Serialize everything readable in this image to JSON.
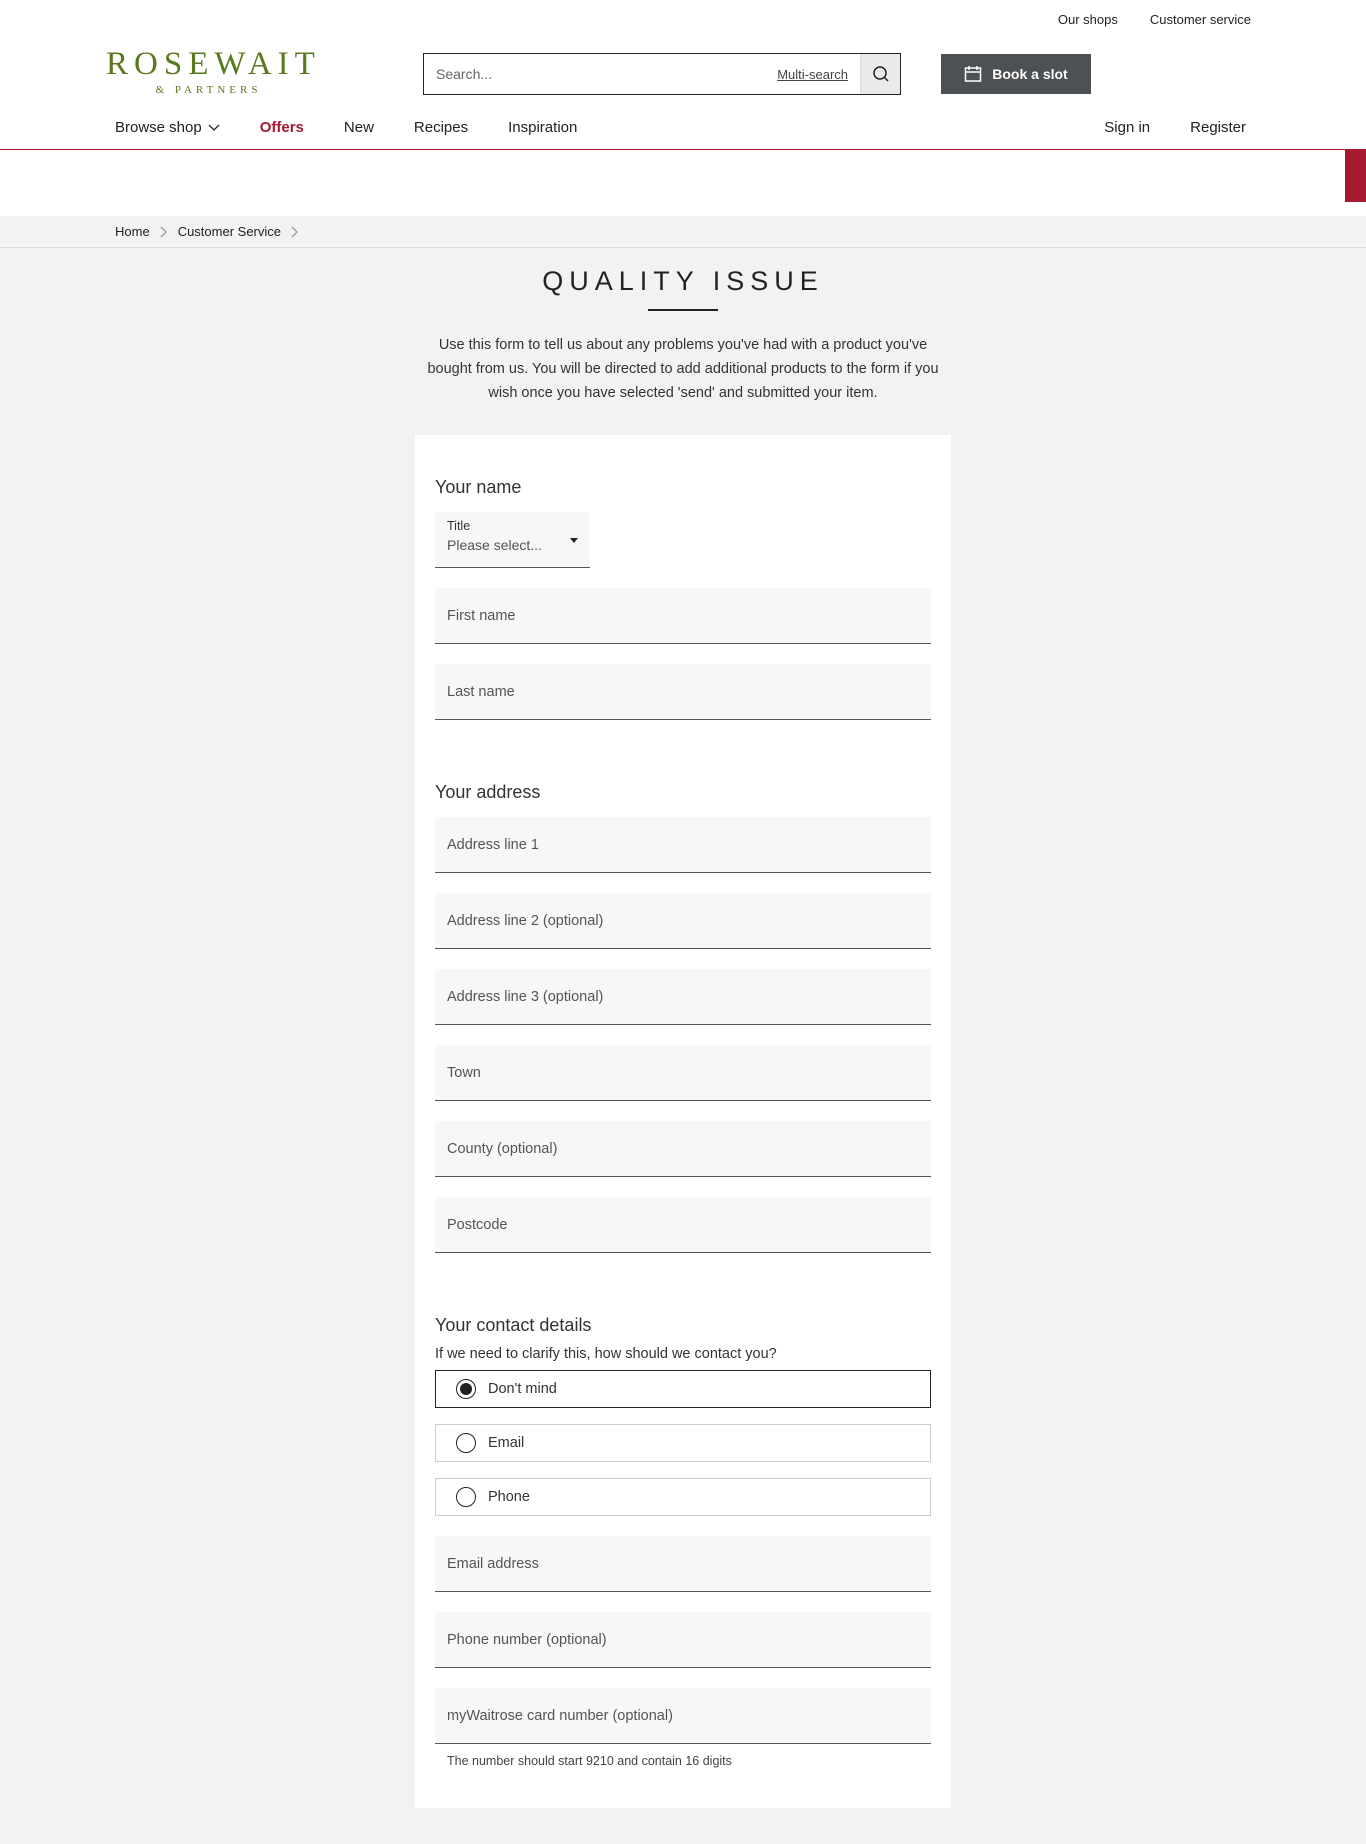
{
  "header": {
    "util_links": [
      "Our shops",
      "Customer service"
    ],
    "logo_main": "ROSEWAIT",
    "logo_sub": "& PARTNERS",
    "search_placeholder": "Search...",
    "multi_search": "Multi-search",
    "book_slot": "Book a slot",
    "nav": [
      "Browse shop",
      "Offers",
      "New",
      "Recipes",
      "Inspiration"
    ],
    "nav_right": [
      "Sign in",
      "Register"
    ],
    "accent_color": "#a6192e",
    "brand_color": "#5a7a1e"
  },
  "breadcrumb": [
    "Home",
    "Customer Service"
  ],
  "page": {
    "title": "QUALITY ISSUE",
    "intro": "Use this form to tell us about any problems you've had with a product you've bought from us. You will be directed to add additional products to the form if you wish once you have selected 'send' and submitted your item."
  },
  "form": {
    "name_section": {
      "heading": "Your name",
      "title_label": "Title",
      "title_value": "Please select...",
      "first_name": "First name",
      "last_name": "Last name"
    },
    "address_section": {
      "heading": "Your address",
      "fields": [
        "Address line 1",
        "Address line 2 (optional)",
        "Address line 3 (optional)",
        "Town",
        "County (optional)",
        "Postcode"
      ]
    },
    "contact_section": {
      "heading": "Your contact details",
      "question": "If we need to clarify this, how should we contact you?",
      "options": [
        "Don't mind",
        "Email",
        "Phone"
      ],
      "selected": "Don't mind",
      "email": "Email address",
      "phone": "Phone number (optional)",
      "card": "myWaitrose card number (optional)",
      "card_hint": "The number should start 9210 and contain 16 digits"
    }
  }
}
